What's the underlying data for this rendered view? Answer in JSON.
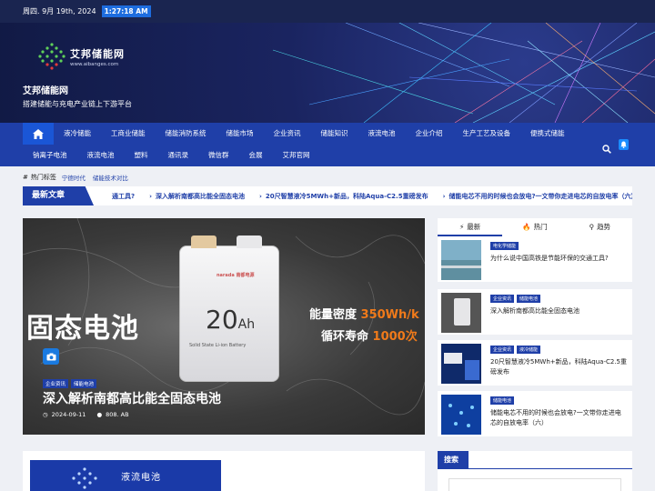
{
  "topbar": {
    "date": "周四. 9月 19th, 2024",
    "time": "1:27:18 AM"
  },
  "header": {
    "logo_name": "艾邦储能网",
    "logo_url": "www.aibanges.com",
    "site_title": "艾邦储能网",
    "site_desc": "搭建储能与充电产业链上下游平台"
  },
  "nav": {
    "home_icon": "home-icon",
    "row1": [
      "液冷储能",
      "工商业储能",
      "储能消防系统",
      "储能市场",
      "企业资讯",
      "储能知识",
      "液流电池",
      "企业介绍",
      "生产工艺及设备",
      "便携式储能"
    ],
    "row2": [
      "钠离子电池",
      "液流电池",
      "塑料",
      "通讯录",
      "微信群",
      "会展",
      "艾邦官网"
    ],
    "search_icon": "search-icon",
    "bell_icon": "bell-icon"
  },
  "hot": {
    "label": "热门标签",
    "tags": [
      "宁德时代",
      "储能技术对比"
    ]
  },
  "ticker": {
    "label": "最新文章",
    "items": [
      "为什么说中国高铁是节能环保的交通工具?",
      "深入解析南都高比能全固态电池",
      "20尺智慧液冷5MWh+新品，科陆Aqua-C2.5重磅发布",
      "储能电芯不用的时候也会放电?一文带你走进电芯的自放电率（六）"
    ],
    "first_partial": "通工具?"
  },
  "hero": {
    "battery_brand": "narada 南都电源",
    "battery_capacity": "20",
    "battery_unit": "Ah",
    "battery_sub": "Solid State Li-ion Battery",
    "big_text": "固态电池",
    "spec1_label": "能量密度",
    "spec1_value": "350Wh/k",
    "spec2_label": "循环寿命",
    "spec2_value": "1000次",
    "tags": [
      "企业资讯",
      "储能电池"
    ],
    "title": "深入解析南都高比能全固态电池",
    "date": "2024-09-11",
    "author": "808. AB"
  },
  "side": {
    "tabs": [
      "最新",
      "热门",
      "趋势"
    ],
    "items": [
      {
        "tags": [
          "电化学储能"
        ],
        "title": "为什么说中国高铁是节能环保的交通工具?"
      },
      {
        "tags": [
          "企业资讯",
          "储能电池"
        ],
        "title": "深入解析南都高比能全固态电池"
      },
      {
        "tags": [
          "企业资讯",
          "液冷储能"
        ],
        "title": "20尺智慧液冷5MWh+新品，科陆Aqua-C2.5重磅发布"
      },
      {
        "tags": [
          "储能电池"
        ],
        "title": "储能电芯不用的时候也会放电?一文带你走进电芯的自放电率（六）"
      }
    ]
  },
  "bottom": {
    "image_text": "液流电池"
  },
  "search": {
    "label": "搜索",
    "placeholder": ""
  },
  "colors": {
    "primary": "#1f3fa8",
    "topbar": "#1a2550",
    "accent": "#1e6ddf"
  }
}
